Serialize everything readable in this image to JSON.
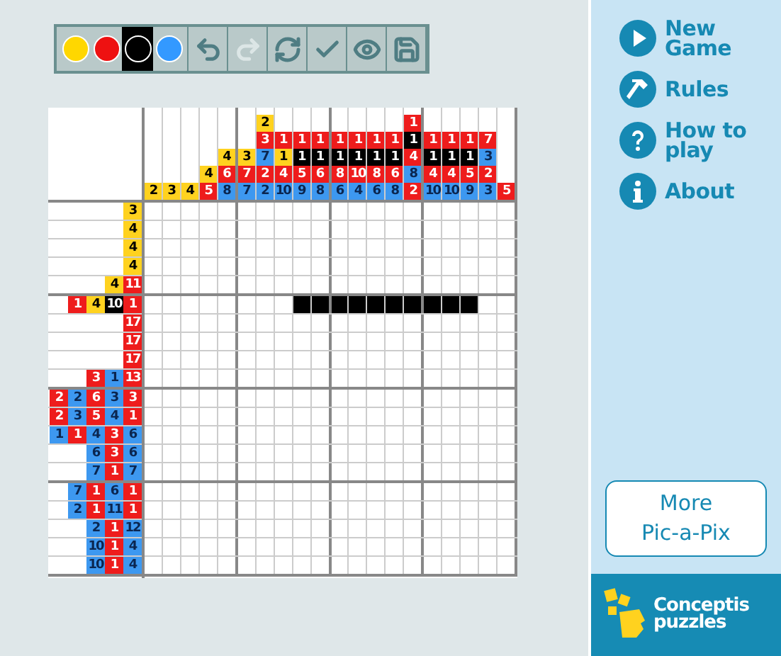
{
  "toolbar": {
    "colors": [
      {
        "color": "#ffd700",
        "selected": false
      },
      {
        "color": "#ee1111",
        "selected": false
      },
      {
        "color": "#000000",
        "selected": true
      },
      {
        "color": "#3399ff",
        "selected": false
      }
    ],
    "tools": [
      {
        "kind": "undo",
        "disabled": false
      },
      {
        "kind": "redo",
        "disabled": true
      },
      {
        "kind": "restart",
        "disabled": false
      },
      {
        "kind": "check",
        "disabled": false
      },
      {
        "kind": "reveal",
        "disabled": false
      },
      {
        "kind": "save",
        "disabled": false
      }
    ]
  },
  "column_clues": [
    [
      {
        "text": "2",
        "color": "#ffd21f"
      }
    ],
    [
      {
        "text": "3",
        "color": "#ffd21f"
      }
    ],
    [
      {
        "text": "4",
        "color": "#ffd21f"
      }
    ],
    [
      {
        "text": "4",
        "color": "#ffd21f"
      },
      {
        "text": "5",
        "color": "#ee1c1c"
      }
    ],
    [
      {
        "text": "4",
        "color": "#ffd21f"
      },
      {
        "text": "6",
        "color": "#ee1c1c"
      },
      {
        "text": "8",
        "color": "#3d98f0"
      }
    ],
    [
      {
        "text": "3",
        "color": "#ffd21f"
      },
      {
        "text": "7",
        "color": "#ee1c1c"
      },
      {
        "text": "7",
        "color": "#3d98f0"
      }
    ],
    [
      {
        "text": "2",
        "color": "#ffd21f"
      },
      {
        "text": "3",
        "color": "#ee1c1c"
      },
      {
        "text": "7",
        "color": "#3d98f0"
      },
      {
        "text": "2",
        "color": "#ee1c1c"
      },
      {
        "text": "2",
        "color": "#3d98f0"
      }
    ],
    [
      {
        "text": "1",
        "color": "#ee1c1c"
      },
      {
        "text": "1",
        "color": "#ffd21f"
      },
      {
        "text": "4",
        "color": "#ee1c1c"
      },
      {
        "text": "10",
        "color": "#3d98f0"
      }
    ],
    [
      {
        "text": "1",
        "color": "#ee1c1c"
      },
      {
        "text": "1",
        "color": "#000000"
      },
      {
        "text": "5",
        "color": "#ee1c1c"
      },
      {
        "text": "9",
        "color": "#3d98f0"
      }
    ],
    [
      {
        "text": "1",
        "color": "#ee1c1c"
      },
      {
        "text": "1",
        "color": "#000000"
      },
      {
        "text": "6",
        "color": "#ee1c1c"
      },
      {
        "text": "8",
        "color": "#3d98f0"
      }
    ],
    [
      {
        "text": "1",
        "color": "#ee1c1c"
      },
      {
        "text": "1",
        "color": "#000000"
      },
      {
        "text": "8",
        "color": "#ee1c1c"
      },
      {
        "text": "6",
        "color": "#3d98f0"
      }
    ],
    [
      {
        "text": "1",
        "color": "#ee1c1c"
      },
      {
        "text": "1",
        "color": "#000000"
      },
      {
        "text": "10",
        "color": "#ee1c1c"
      },
      {
        "text": "4",
        "color": "#3d98f0"
      }
    ],
    [
      {
        "text": "1",
        "color": "#ee1c1c"
      },
      {
        "text": "1",
        "color": "#000000"
      },
      {
        "text": "8",
        "color": "#ee1c1c"
      },
      {
        "text": "6",
        "color": "#3d98f0"
      }
    ],
    [
      {
        "text": "1",
        "color": "#ee1c1c"
      },
      {
        "text": "1",
        "color": "#000000"
      },
      {
        "text": "6",
        "color": "#ee1c1c"
      },
      {
        "text": "8",
        "color": "#3d98f0"
      }
    ],
    [
      {
        "text": "1",
        "color": "#ee1c1c"
      },
      {
        "text": "1",
        "color": "#000000"
      },
      {
        "text": "4",
        "color": "#ee1c1c"
      },
      {
        "text": "8",
        "color": "#3d98f0"
      },
      {
        "text": "2",
        "color": "#ee1c1c"
      }
    ],
    [
      {
        "text": "1",
        "color": "#ee1c1c"
      },
      {
        "text": "1",
        "color": "#000000"
      },
      {
        "text": "4",
        "color": "#ee1c1c"
      },
      {
        "text": "10",
        "color": "#3d98f0"
      }
    ],
    [
      {
        "text": "1",
        "color": "#ee1c1c"
      },
      {
        "text": "1",
        "color": "#000000"
      },
      {
        "text": "4",
        "color": "#ee1c1c"
      },
      {
        "text": "10",
        "color": "#3d98f0"
      }
    ],
    [
      {
        "text": "1",
        "color": "#ee1c1c"
      },
      {
        "text": "1",
        "color": "#000000"
      },
      {
        "text": "5",
        "color": "#ee1c1c"
      },
      {
        "text": "9",
        "color": "#3d98f0"
      }
    ],
    [
      {
        "text": "7",
        "color": "#ee1c1c"
      },
      {
        "text": "3",
        "color": "#3d98f0"
      },
      {
        "text": "2",
        "color": "#ee1c1c"
      },
      {
        "text": "3",
        "color": "#3d98f0"
      }
    ],
    [
      {
        "text": "5",
        "color": "#ee1c1c"
      }
    ]
  ],
  "row_clues": [
    [
      {
        "text": "3",
        "color": "#ffd21f"
      }
    ],
    [
      {
        "text": "4",
        "color": "#ffd21f"
      }
    ],
    [
      {
        "text": "4",
        "color": "#ffd21f"
      }
    ],
    [
      {
        "text": "4",
        "color": "#ffd21f"
      }
    ],
    [
      {
        "text": "4",
        "color": "#ffd21f"
      },
      {
        "text": "11",
        "color": "#ee1c1c"
      }
    ],
    [
      {
        "text": "1",
        "color": "#ee1c1c"
      },
      {
        "text": "4",
        "color": "#ffd21f"
      },
      {
        "text": "10",
        "color": "#000000"
      },
      {
        "text": "1",
        "color": "#ee1c1c"
      }
    ],
    [
      {
        "text": "17",
        "color": "#ee1c1c"
      }
    ],
    [
      {
        "text": "17",
        "color": "#ee1c1c"
      }
    ],
    [
      {
        "text": "17",
        "color": "#ee1c1c"
      }
    ],
    [
      {
        "text": "3",
        "color": "#ee1c1c"
      },
      {
        "text": "1",
        "color": "#3d98f0"
      },
      {
        "text": "13",
        "color": "#ee1c1c"
      }
    ],
    [
      {
        "text": "2",
        "color": "#ee1c1c"
      },
      {
        "text": "2",
        "color": "#3d98f0"
      },
      {
        "text": "6",
        "color": "#ee1c1c"
      },
      {
        "text": "3",
        "color": "#3d98f0"
      },
      {
        "text": "3",
        "color": "#ee1c1c"
      }
    ],
    [
      {
        "text": "2",
        "color": "#ee1c1c"
      },
      {
        "text": "3",
        "color": "#3d98f0"
      },
      {
        "text": "5",
        "color": "#ee1c1c"
      },
      {
        "text": "4",
        "color": "#3d98f0"
      },
      {
        "text": "1",
        "color": "#ee1c1c"
      }
    ],
    [
      {
        "text": "1",
        "color": "#3d98f0"
      },
      {
        "text": "1",
        "color": "#ee1c1c"
      },
      {
        "text": "4",
        "color": "#3d98f0"
      },
      {
        "text": "3",
        "color": "#ee1c1c"
      },
      {
        "text": "6",
        "color": "#3d98f0"
      }
    ],
    [
      {
        "text": "6",
        "color": "#3d98f0"
      },
      {
        "text": "3",
        "color": "#ee1c1c"
      },
      {
        "text": "6",
        "color": "#3d98f0"
      }
    ],
    [
      {
        "text": "7",
        "color": "#3d98f0"
      },
      {
        "text": "1",
        "color": "#ee1c1c"
      },
      {
        "text": "7",
        "color": "#3d98f0"
      }
    ],
    [
      {
        "text": "7",
        "color": "#3d98f0"
      },
      {
        "text": "1",
        "color": "#ee1c1c"
      },
      {
        "text": "6",
        "color": "#3d98f0"
      },
      {
        "text": "1",
        "color": "#ee1c1c"
      }
    ],
    [
      {
        "text": "2",
        "color": "#3d98f0"
      },
      {
        "text": "1",
        "color": "#ee1c1c"
      },
      {
        "text": "11",
        "color": "#3d98f0"
      },
      {
        "text": "1",
        "color": "#ee1c1c"
      }
    ],
    [
      {
        "text": "2",
        "color": "#3d98f0"
      },
      {
        "text": "1",
        "color": "#ee1c1c"
      },
      {
        "text": "12",
        "color": "#3d98f0"
      }
    ],
    [
      {
        "text": "10",
        "color": "#3d98f0"
      },
      {
        "text": "1",
        "color": "#ee1c1c"
      },
      {
        "text": "4",
        "color": "#3d98f0"
      }
    ],
    [
      {
        "text": "10",
        "color": "#3d98f0"
      },
      {
        "text": "1",
        "color": "#ee1c1c"
      },
      {
        "text": "4",
        "color": "#3d98f0"
      }
    ]
  ],
  "grid": [
    [
      false,
      false,
      false,
      false,
      false,
      false,
      false,
      false,
      false,
      false,
      false,
      false,
      false,
      false,
      false,
      false,
      false,
      false,
      false,
      false
    ],
    [
      false,
      false,
      false,
      false,
      false,
      false,
      false,
      false,
      false,
      false,
      false,
      false,
      false,
      false,
      false,
      false,
      false,
      false,
      false,
      false
    ],
    [
      false,
      false,
      false,
      false,
      false,
      false,
      false,
      false,
      false,
      false,
      false,
      false,
      false,
      false,
      false,
      false,
      false,
      false,
      false,
      false
    ],
    [
      false,
      false,
      false,
      false,
      false,
      false,
      false,
      false,
      false,
      false,
      false,
      false,
      false,
      false,
      false,
      false,
      false,
      false,
      false,
      false
    ],
    [
      false,
      false,
      false,
      false,
      false,
      false,
      false,
      false,
      false,
      false,
      false,
      false,
      false,
      false,
      false,
      false,
      false,
      false,
      false,
      false
    ],
    [
      false,
      false,
      false,
      false,
      false,
      false,
      false,
      false,
      true,
      true,
      true,
      true,
      true,
      true,
      true,
      true,
      true,
      true,
      false,
      false
    ],
    [
      false,
      false,
      false,
      false,
      false,
      false,
      false,
      false,
      false,
      false,
      false,
      false,
      false,
      false,
      false,
      false,
      false,
      false,
      false,
      false
    ],
    [
      false,
      false,
      false,
      false,
      false,
      false,
      false,
      false,
      false,
      false,
      false,
      false,
      false,
      false,
      false,
      false,
      false,
      false,
      false,
      false
    ],
    [
      false,
      false,
      false,
      false,
      false,
      false,
      false,
      false,
      false,
      false,
      false,
      false,
      false,
      false,
      false,
      false,
      false,
      false,
      false,
      false
    ],
    [
      false,
      false,
      false,
      false,
      false,
      false,
      false,
      false,
      false,
      false,
      false,
      false,
      false,
      false,
      false,
      false,
      false,
      false,
      false,
      false
    ],
    [
      false,
      false,
      false,
      false,
      false,
      false,
      false,
      false,
      false,
      false,
      false,
      false,
      false,
      false,
      false,
      false,
      false,
      false,
      false,
      false
    ],
    [
      false,
      false,
      false,
      false,
      false,
      false,
      false,
      false,
      false,
      false,
      false,
      false,
      false,
      false,
      false,
      false,
      false,
      false,
      false,
      false
    ],
    [
      false,
      false,
      false,
      false,
      false,
      false,
      false,
      false,
      false,
      false,
      false,
      false,
      false,
      false,
      false,
      false,
      false,
      false,
      false,
      false
    ],
    [
      false,
      false,
      false,
      false,
      false,
      false,
      false,
      false,
      false,
      false,
      false,
      false,
      false,
      false,
      false,
      false,
      false,
      false,
      false,
      false
    ],
    [
      false,
      false,
      false,
      false,
      false,
      false,
      false,
      false,
      false,
      false,
      false,
      false,
      false,
      false,
      false,
      false,
      false,
      false,
      false,
      false
    ],
    [
      false,
      false,
      false,
      false,
      false,
      false,
      false,
      false,
      false,
      false,
      false,
      false,
      false,
      false,
      false,
      false,
      false,
      false,
      false,
      false
    ],
    [
      false,
      false,
      false,
      false,
      false,
      false,
      false,
      false,
      false,
      false,
      false,
      false,
      false,
      false,
      false,
      false,
      false,
      false,
      false,
      false
    ],
    [
      false,
      false,
      false,
      false,
      false,
      false,
      false,
      false,
      false,
      false,
      false,
      false,
      false,
      false,
      false,
      false,
      false,
      false,
      false,
      false
    ],
    [
      false,
      false,
      false,
      false,
      false,
      false,
      false,
      false,
      false,
      false,
      false,
      false,
      false,
      false,
      false,
      false,
      false,
      false,
      false,
      false
    ],
    [
      false,
      false,
      false,
      false,
      false,
      false,
      false,
      false,
      false,
      false,
      false,
      false,
      false,
      false,
      false,
      false,
      false,
      false,
      false,
      false
    ]
  ],
  "menu": [
    {
      "kind": "play",
      "lines": [
        "New",
        "Game"
      ]
    },
    {
      "kind": "hammer",
      "lines": [
        "Rules"
      ]
    },
    {
      "kind": "help",
      "lines": [
        "How to",
        "play"
      ]
    },
    {
      "kind": "info",
      "lines": [
        "About"
      ]
    }
  ],
  "more_button": {
    "lines": [
      "More",
      "Pic-a-Pix"
    ]
  },
  "logo": {
    "lines": [
      "Conceptis",
      "puzzles"
    ]
  }
}
